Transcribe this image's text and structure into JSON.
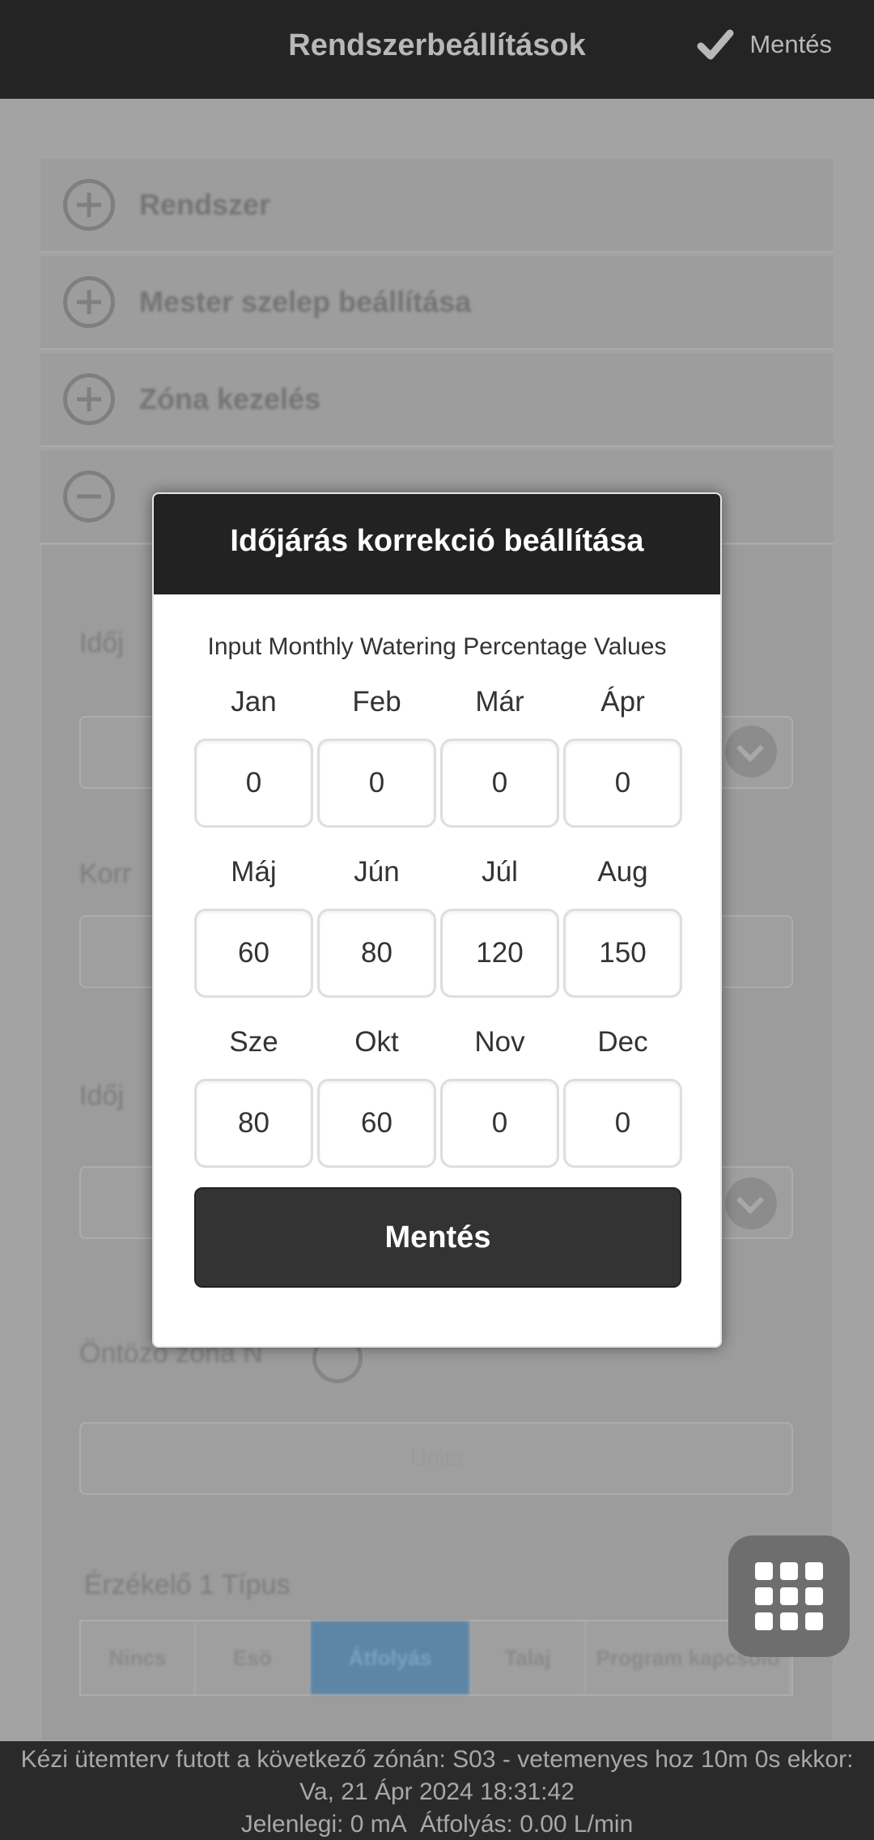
{
  "header": {
    "title": "Rendszerbeállítások",
    "save_label": "Mentés"
  },
  "background": {
    "accordion": [
      {
        "label": "Rendszer"
      },
      {
        "label": "Mester szelep beállítása"
      },
      {
        "label": "Zóna kezelés"
      }
    ],
    "label_1": "Időj",
    "label_2": "Korr",
    "label_3": "Időj",
    "label_4": "Öntöző zóna N",
    "field_units": "Units",
    "sensor_type_label": "Érzékelő 1 Típus",
    "tabs": [
      "Nincs",
      "Esö",
      "Átfolyás",
      "Talaj",
      "Program kapcsoló"
    ]
  },
  "modal": {
    "title": "Időjárás korrekció beállítása",
    "subtitle": "Input Monthly Watering Percentage Values",
    "months": [
      {
        "label": "Jan",
        "value": "0"
      },
      {
        "label": "Feb",
        "value": "0"
      },
      {
        "label": "Már",
        "value": "0"
      },
      {
        "label": "Ápr",
        "value": "0"
      },
      {
        "label": "Máj",
        "value": "60"
      },
      {
        "label": "Jún",
        "value": "80"
      },
      {
        "label": "Júl",
        "value": "120"
      },
      {
        "label": "Aug",
        "value": "150"
      },
      {
        "label": "Sze",
        "value": "80"
      },
      {
        "label": "Okt",
        "value": "60"
      },
      {
        "label": "Nov",
        "value": "0"
      },
      {
        "label": "Dec",
        "value": "0"
      }
    ],
    "save_label": "Mentés"
  },
  "footer": {
    "line1": "Kézi ütemterv futott a következő zónán: S03 - vetemenyes hoz 10m 0s ekkor:",
    "line2": "Va, 21 Ápr 2024 18:31:42",
    "current": "Jelenlegi: 0 mA",
    "flow": "Átfolyás: 0.00 L/min"
  },
  "colors": {
    "header_bg": "#242424",
    "modal_header_bg": "#222222",
    "save_button_bg": "#333333",
    "active_tab": "#5d86a6"
  }
}
